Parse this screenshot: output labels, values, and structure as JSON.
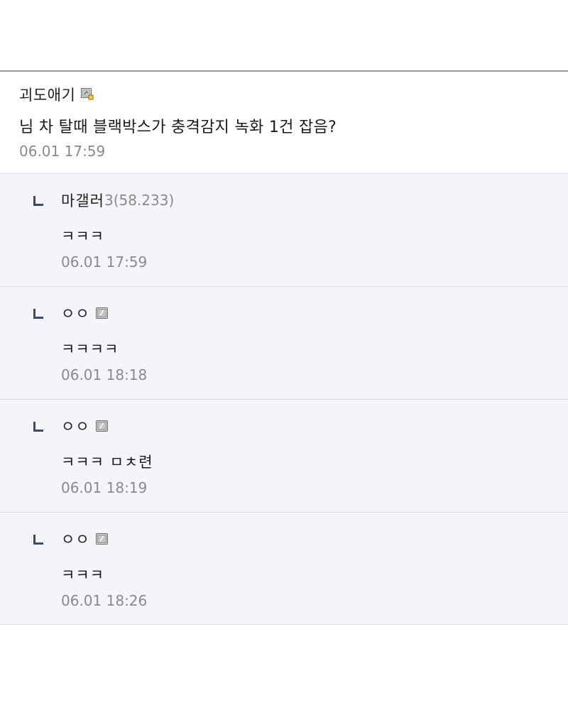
{
  "post": {
    "author": "괴도애기",
    "author_icon": "member-level-icon",
    "body": "님 차 탈때 블랙박스가 충격감지 녹화 1건 잡음?",
    "time": "06.01 17:59"
  },
  "comments": [
    {
      "author": "마갤러",
      "ip": "3(58.233)",
      "body": "ㅋㅋㅋ",
      "time": "06.01 17:59",
      "icon": ""
    },
    {
      "author": "ㅇㅇ",
      "ip": "",
      "body": "ㅋㅋㅋㅋ",
      "time": "06.01 18:18",
      "icon": "fixed-nick-icon"
    },
    {
      "author": "ㅇㅇ",
      "ip": "",
      "body": "ㅋㅋㅋ ㅁㅊ련",
      "time": "06.01 18:19",
      "icon": "fixed-nick-icon"
    },
    {
      "author": "ㅇㅇ",
      "ip": "",
      "body": "ㅋㅋㅋ",
      "time": "06.01 18:26",
      "icon": "fixed-nick-icon"
    }
  ],
  "colors": {
    "comment_bg": "#f3f5f9",
    "reply_mark": "#3b4a6b",
    "time_text": "#8a8a8a",
    "divider": "#d5d9e0"
  }
}
